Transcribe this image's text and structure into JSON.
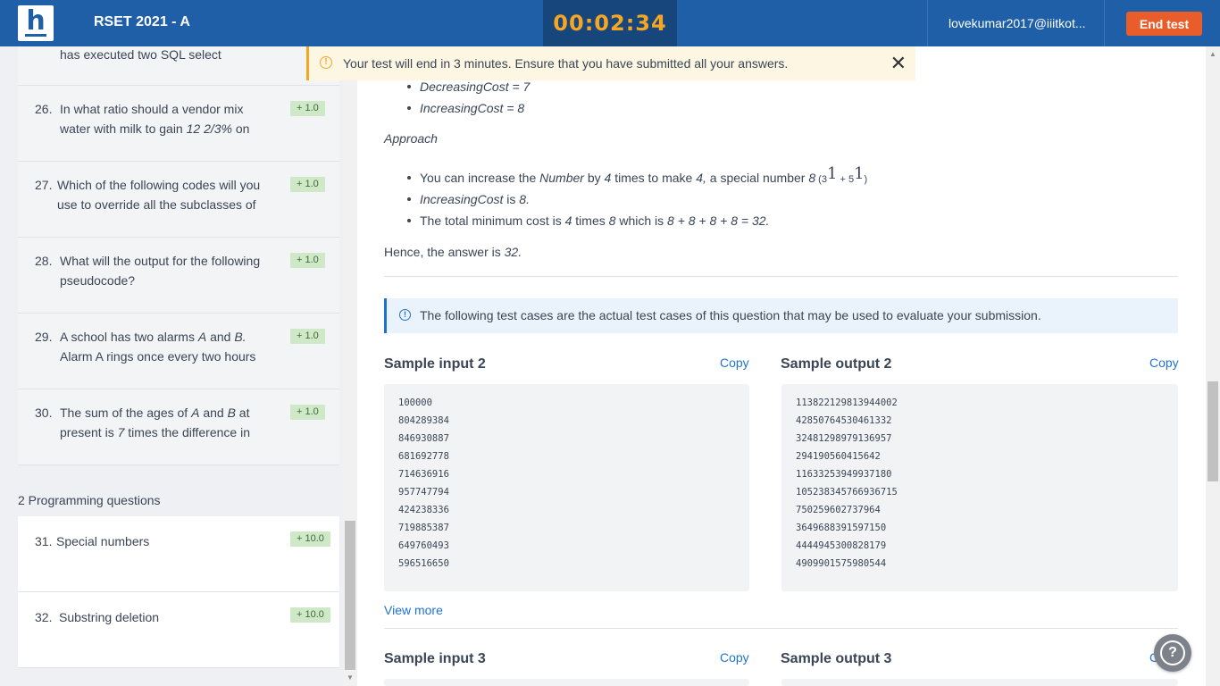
{
  "header": {
    "test_title": "RSET 2021 - A",
    "timer": "00:02:34",
    "user_email": "lovekumar2017@iiitkot...",
    "end_test_label": "End test",
    "logo_letter": "h"
  },
  "warning": {
    "text": "Your test will end in 3 minutes. Ensure that you have submitted all your answers."
  },
  "sidebar": {
    "partial_item_text": "has executed two SQL select",
    "questions": [
      {
        "num": "26.",
        "line1": "In what ratio should a vendor mix",
        "line2_pre": "water with milk to gain ",
        "line2_it": "12 2/3%",
        "line2_post": " on",
        "badge": "+ 1.0"
      },
      {
        "num": "27.",
        "line1": "Which of the following codes will you",
        "line2": "use to override all the subclasses of",
        "badge": "+ 1.0"
      },
      {
        "num": "28.",
        "line1": "What will the output for the following",
        "line2": "pseudocode?",
        "badge": "+ 1.0"
      },
      {
        "num": "29.",
        "line1_pre": "A school has two alarms ",
        "line1_a": "A",
        "line1_mid": " and ",
        "line1_b": "B.",
        "line2": "Alarm A rings once every two hours",
        "badge": "+ 1.0"
      },
      {
        "num": "30.",
        "line1_pre": "The sum of the ages of ",
        "line1_a": "A",
        "line1_mid": " and ",
        "line1_b": "B",
        "line1_post": " at",
        "line2_pre": "present is ",
        "line2_it": "7",
        "line2_post": " times the difference in",
        "badge": "+ 1.0"
      }
    ],
    "programming_label": "2 Programming questions",
    "programming": [
      {
        "num": "31.",
        "title": "Special numbers",
        "badge": "+ 10.0"
      },
      {
        "num": "32.",
        "title": "Substring deletion",
        "badge": "+ 10.0"
      }
    ]
  },
  "content": {
    "top_bullets": [
      "DecreasingCost = 7",
      "IncreasingCost = 8"
    ],
    "approach_label": "Approach",
    "bullet1": {
      "pre": "You can increase the ",
      "number": "Number",
      "mid1": " by ",
      "four": "4",
      "mid2": " times to make ",
      "four2": "4,",
      "mid3": " a special number ",
      "eight": "8",
      "paren_open": " (3",
      "exp1": "1",
      "plus": " + 5",
      "exp2": "1",
      "paren_close": ")"
    },
    "bullet2": {
      "it": "IncreasingCost",
      "mid": " is ",
      "val": "8."
    },
    "bullet3": {
      "pre": "The total minimum cost is ",
      "four": "4",
      "mid": " times ",
      "eight": "8",
      "mid2": " which is ",
      "expr": "8 + 8 + 8 + 8 = 32."
    },
    "hence_pre": "Hence, the answer is ",
    "hence_val": "32.",
    "info_text": "The following test cases are the actual test cases of this question that may be used to evaluate your submission.",
    "sample_input_2_title": "Sample input 2",
    "sample_output_2_title": "Sample output 2",
    "copy_label": "Copy",
    "sample_input_2": [
      "100000",
      "804289384",
      "846930887",
      "681692778",
      "714636916",
      "957747794",
      "424238336",
      "719885387",
      "649760493",
      "596516650"
    ],
    "sample_output_2": [
      "113822129813944002",
      "42850764530461332",
      "32481298979136957",
      "294190560415642",
      "11633253949937180",
      "105238345766936715",
      "750259602737964",
      "3649688391597150",
      "4444945300828179",
      "4909901575980544"
    ],
    "view_more": "View more",
    "sample_input_3_title": "Sample input 3",
    "sample_output_3_title": "Sample output 3",
    "copy3_partial": "C"
  },
  "help": {
    "symbol": "?"
  }
}
